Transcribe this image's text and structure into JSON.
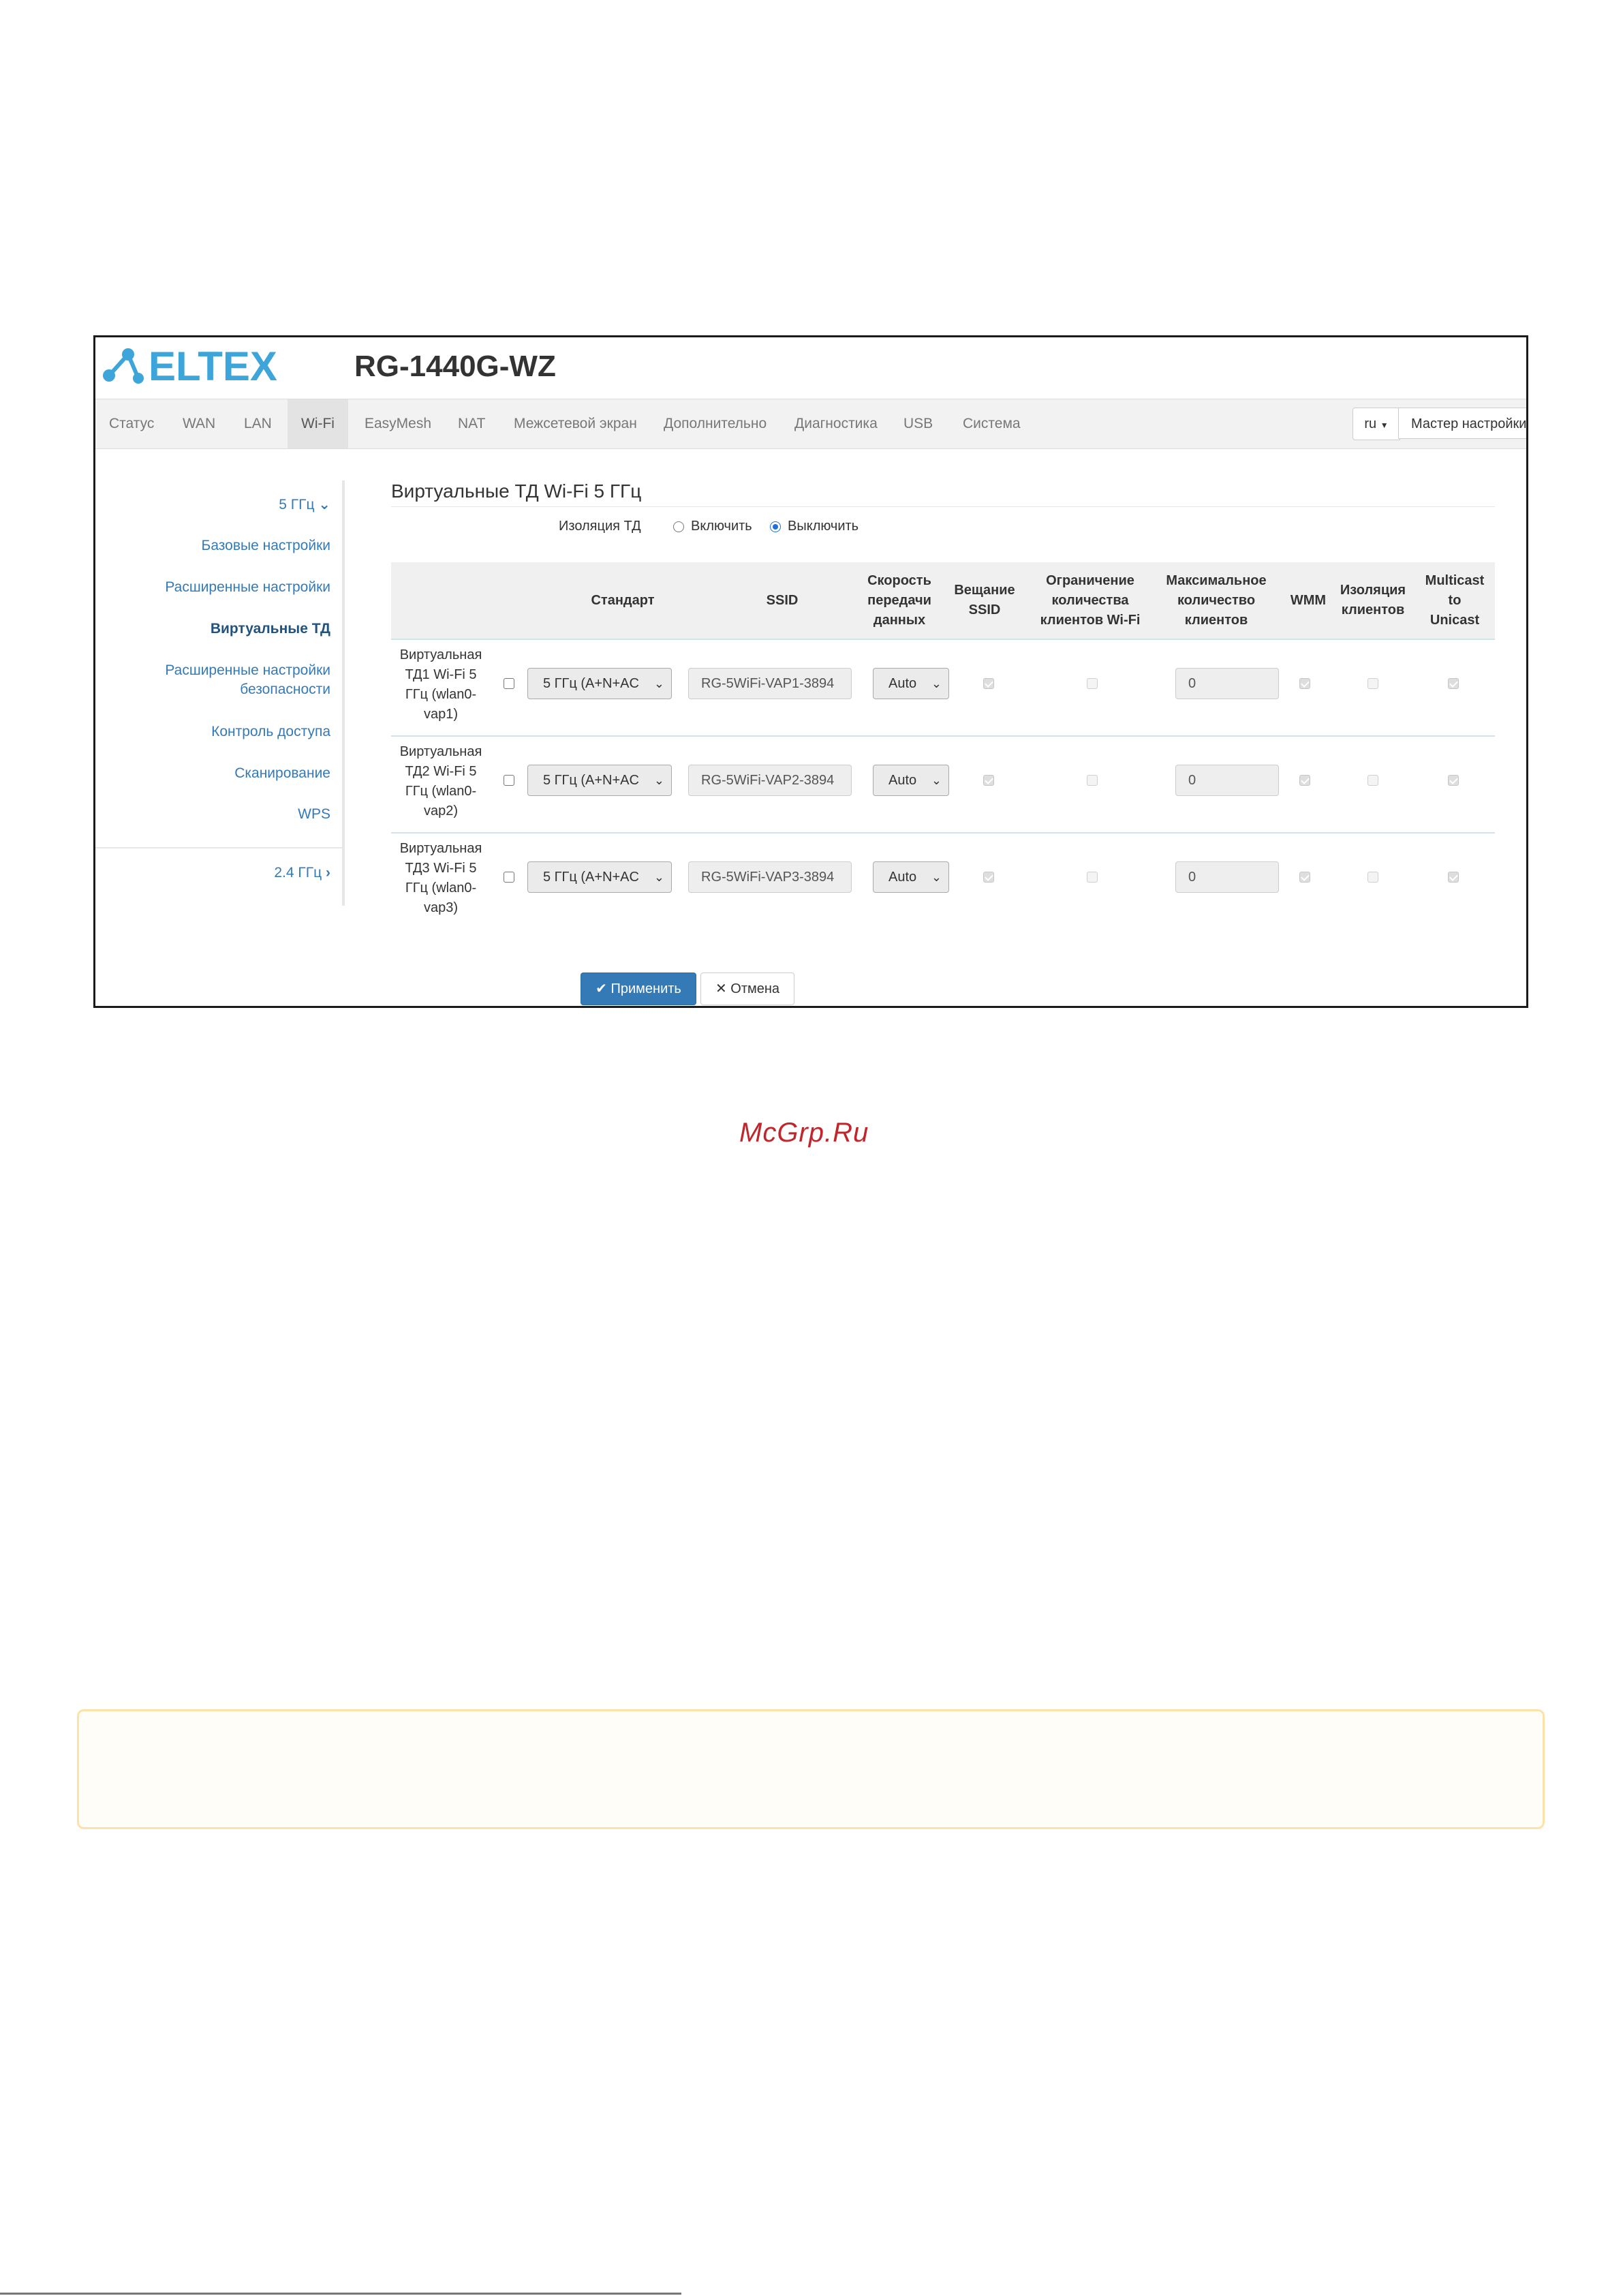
{
  "header": {
    "logo_text": "ELTEX",
    "model": "RG-1440G-WZ"
  },
  "nav": {
    "items": [
      "Статус",
      "WAN",
      "LAN",
      "Wi-Fi",
      "EasyMesh",
      "NAT",
      "Межсетевой экран",
      "Дополнительно",
      "Диагностика",
      "USB",
      "Система"
    ],
    "active": "Wi-Fi",
    "lang": "ru",
    "wizard": "Мастер настройки"
  },
  "sidebar": {
    "group_5": "5 ГГц",
    "items": [
      "Базовые настройки",
      "Расширенные настройки",
      "Виртуальные ТД",
      "Расширенные настройки",
      "безопасности",
      "Контроль доступа",
      "Сканирование",
      "WPS"
    ],
    "active": "Виртуальные ТД",
    "group_24": "2.4 ГГц"
  },
  "main": {
    "title": "Виртуальные ТД Wi-Fi 5 ГГц",
    "isolation": {
      "label": "Изоляция ТД",
      "on": "Включить",
      "off": "Выключить",
      "selected": "off"
    },
    "table": {
      "headers": {
        "standard": "Стандарт",
        "ssid": "SSID",
        "rate": [
          "Скорость",
          "передачи",
          "данных"
        ],
        "broadcast": [
          "Вещание",
          "SSID"
        ],
        "limit": [
          "Ограничение",
          "количества",
          "клиентов Wi-Fi"
        ],
        "max": [
          "Максимальное",
          "количество",
          "клиентов"
        ],
        "wmm": "WMM",
        "isolation": [
          "Изоляция",
          "клиентов"
        ],
        "multicast": [
          "Multicast",
          "to",
          "Unicast"
        ]
      },
      "rows": [
        {
          "label": [
            "Виртуальная",
            "ТД1 Wi-Fi 5",
            "ГГц (wlan0-",
            "vap1)"
          ],
          "enabled": false,
          "standard": "5 ГГц (A+N+AC",
          "ssid": "RG-5WiFi-VAP1-3894",
          "rate": "Auto",
          "broadcast": true,
          "limit": false,
          "max": "0",
          "wmm": true,
          "isolation": false,
          "multicast": true
        },
        {
          "label": [
            "Виртуальная",
            "ТД2 Wi-Fi 5",
            "ГГц (wlan0-",
            "vap2)"
          ],
          "enabled": false,
          "standard": "5 ГГц (A+N+AC",
          "ssid": "RG-5WiFi-VAP2-3894",
          "rate": "Auto",
          "broadcast": true,
          "limit": false,
          "max": "0",
          "wmm": true,
          "isolation": false,
          "multicast": true
        },
        {
          "label": [
            "Виртуальная",
            "ТД3 Wi-Fi 5",
            "ГГц (wlan0-",
            "vap3)"
          ],
          "enabled": false,
          "standard": "5 ГГц (A+N+AC",
          "ssid": "RG-5WiFi-VAP3-3894",
          "rate": "Auto",
          "broadcast": true,
          "limit": false,
          "max": "0",
          "wmm": true,
          "isolation": false,
          "multicast": true
        }
      ]
    },
    "apply_label": "Применить",
    "cancel_label": "Отмена"
  },
  "watermark": "McGrp.Ru",
  "colors": {
    "accent": "#337ab7",
    "logo": "#3da5d9",
    "watermark": "#c0262c",
    "note_border": "#fde2a8"
  }
}
